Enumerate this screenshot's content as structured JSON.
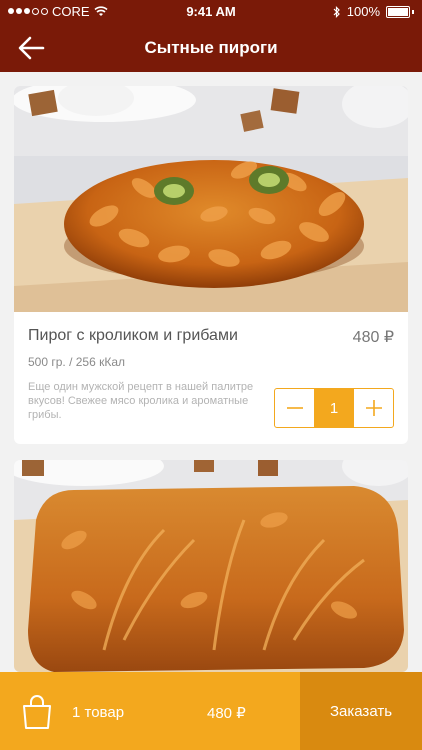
{
  "status_bar": {
    "carrier": "CORE",
    "time": "9:41 AM",
    "battery": "100%",
    "wifi_icon": "wifi-icon",
    "bluetooth_icon": "bluetooth-icon"
  },
  "header": {
    "title": "Сытные пироги",
    "back_icon": "arrow-left-icon",
    "background": "#7a1a08"
  },
  "products": [
    {
      "name": "Пирог с кроликом и грибами",
      "price": "480 ₽",
      "weight": "500 гр. / 256 кКал",
      "description": "Еще один мужской рецепт в нашей палитре вкусов! Свежее мясо кролика и ароматные грибы.",
      "quantity": "1",
      "minus_icon": "minus-icon",
      "plus_icon": "plus-icon",
      "image": "oval-pie-photo"
    },
    {
      "image": "rectangular-pie-photo"
    }
  ],
  "cart": {
    "bag_icon": "shopping-bag-icon",
    "count": "1 товар",
    "total": "480 ₽",
    "order_label": "Заказать",
    "accent": "#f3a81e",
    "order_color": "#d98a10"
  }
}
